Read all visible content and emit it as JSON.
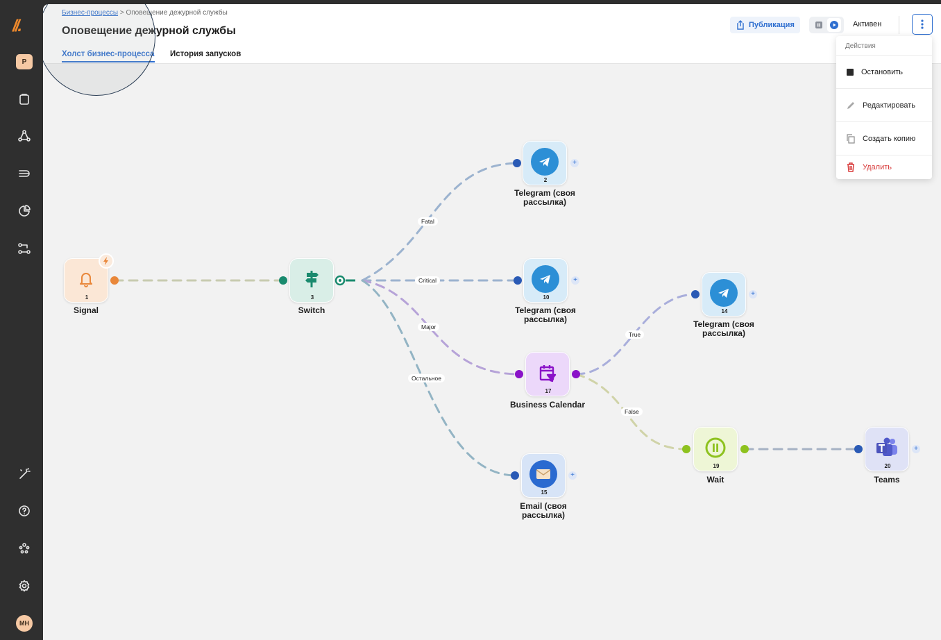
{
  "breadcrumb": {
    "parent": "Бизнес-процессы",
    "separator": ">",
    "current": "Оповещение дежурной службы"
  },
  "page": {
    "title": "Оповещение дежурной службы"
  },
  "tabs": [
    {
      "label": "Холст бизнес-процесса"
    },
    {
      "label": "История запусков"
    }
  ],
  "toolbar": {
    "publish_label": "Публикация",
    "status_label": "Активен"
  },
  "sidebar": {
    "workspace_badge": "P",
    "user_initials": "MH"
  },
  "menu": {
    "header": "Действия",
    "items": [
      {
        "label": "Остановить"
      },
      {
        "label": "Редактировать"
      },
      {
        "label": "Создать копию"
      },
      {
        "label": "Удалить"
      }
    ]
  },
  "nodes": [
    {
      "id": "1",
      "label": "Signal"
    },
    {
      "id": "3",
      "label": "Switch"
    },
    {
      "id": "2",
      "label": "Telegram (своя рассылка)"
    },
    {
      "id": "10",
      "label": "Telegram (своя рассылка)"
    },
    {
      "id": "17",
      "label": "Business Calendar"
    },
    {
      "id": "15",
      "label": "Email (своя рассылка)"
    },
    {
      "id": "14",
      "label": "Telegram (своя рассылка)"
    },
    {
      "id": "19",
      "label": "Wait"
    },
    {
      "id": "20",
      "label": "Teams"
    }
  ],
  "edge_labels": {
    "fatal": "Fatal",
    "critical": "Critical",
    "major": "Major",
    "other": "Остальное",
    "true": "True",
    "false": "False"
  },
  "colors": {
    "accent": "#2f6fd0",
    "danger": "#d83a3a",
    "signal": "#e9873a",
    "switch": "#1a8a6e",
    "telegram": "#2c8fd6",
    "calendar": "#8a2bd6",
    "wait": "#8ec21f",
    "teams": "#4b53bc"
  }
}
